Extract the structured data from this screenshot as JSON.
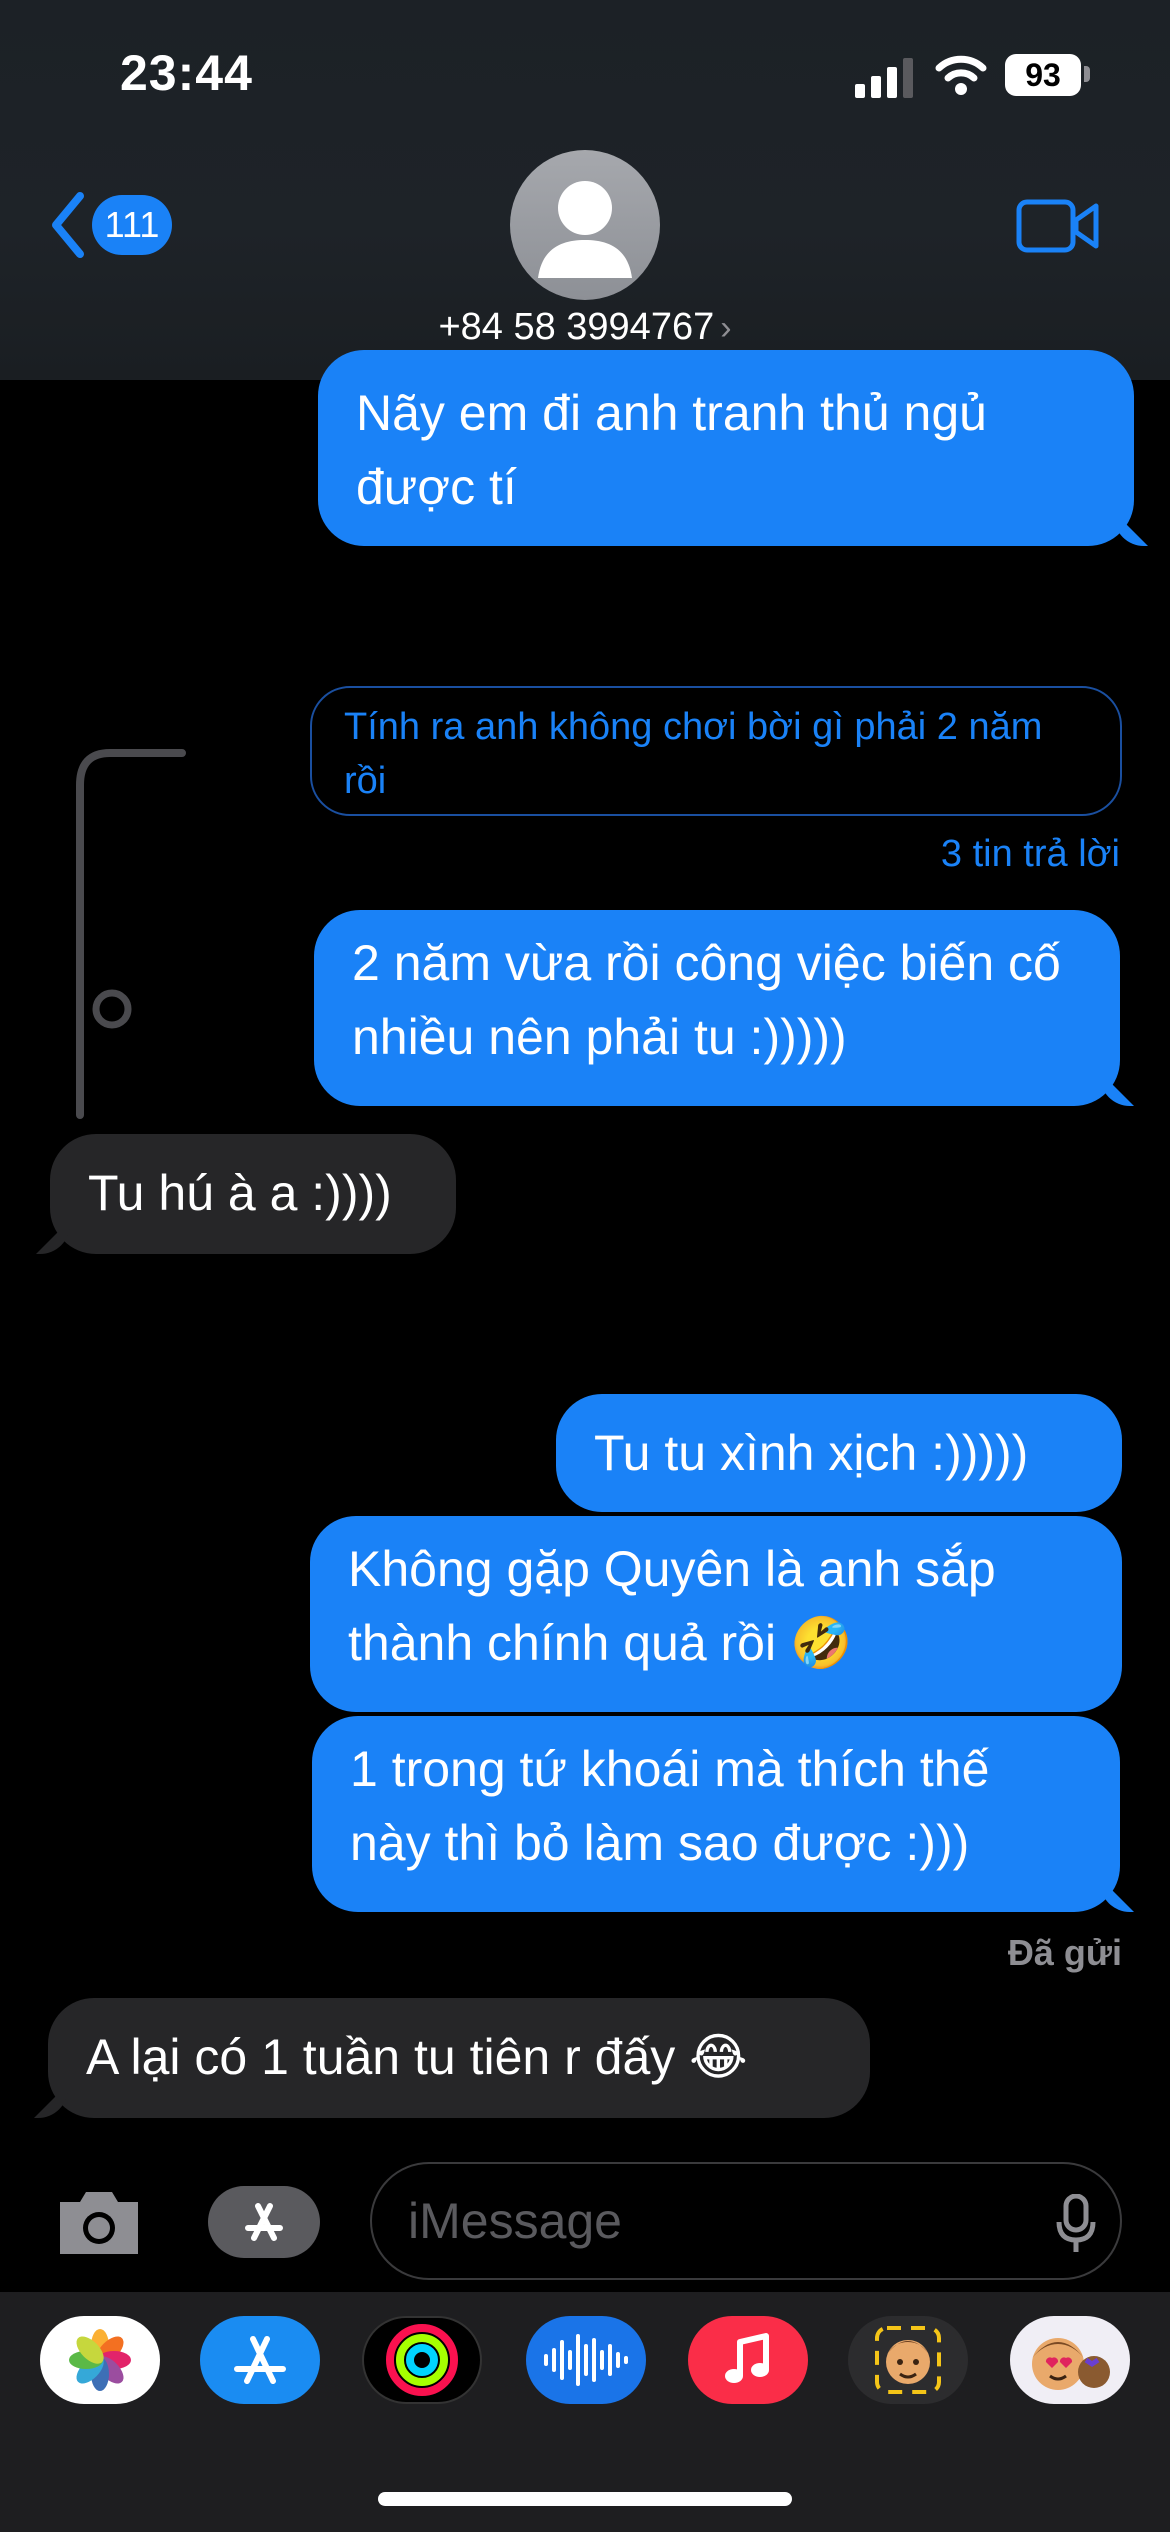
{
  "status": {
    "time": "23:44",
    "battery": "93"
  },
  "header": {
    "back_badge": "111",
    "contact": "+84 58 3994767"
  },
  "messages": [
    {
      "dir": "out",
      "text": "Nãy em đi anh tranh thủ ngủ được tí"
    },
    {
      "dir": "quote",
      "text": "Tính ra anh không chơi bời gì phải 2 năm rồi"
    },
    {
      "dir": "out",
      "text": "2 năm vừa rồi công việc biến cố nhiều nên phải tu :)))))"
    },
    {
      "dir": "in",
      "text": "Tu hú à a :))))"
    },
    {
      "dir": "out",
      "text": "Tu tu xình xịch :)))))"
    },
    {
      "dir": "out",
      "text": "Không gặp Quyên là anh sắp thành chính quả rồi 🤣"
    },
    {
      "dir": "out",
      "text": "1 trong tứ khoái mà thích thế này thì bỏ làm sao được :)))"
    },
    {
      "dir": "in",
      "text": "A lại có 1 tuần tu tiên r đấy 😂"
    }
  ],
  "thread": {
    "reply_count": "3 tin trả lời"
  },
  "delivered": "Đã gửi",
  "input": {
    "placeholder": "iMessage"
  },
  "apps": [
    "photos-icon",
    "app-store-icon",
    "fitness-icon",
    "audio-message-icon",
    "music-icon",
    "memoji-icon",
    "stickers-icon"
  ],
  "colors": {
    "accent": "#1a82f7",
    "incoming": "#262628",
    "background": "#000000"
  }
}
